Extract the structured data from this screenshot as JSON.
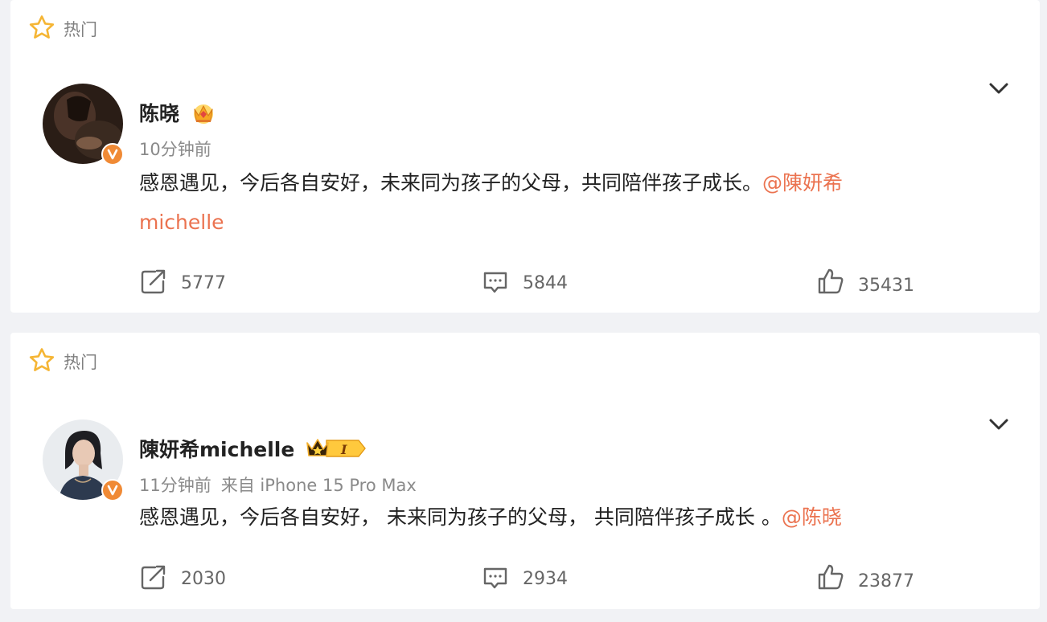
{
  "posts": [
    {
      "hot_label": "热门",
      "author": "陈晓",
      "time": "10分钟前",
      "source": "",
      "text_plain": "感恩遇见，今后各自安好，未来同为孩子的父母，共同陪伴孩子成长。",
      "mention_line1": "@陳妍希",
      "mention_line2": "michelle",
      "reposts": "5777",
      "comments": "5844",
      "likes": "35431"
    },
    {
      "hot_label": "热门",
      "author": "陳妍希michelle",
      "time": "11分钟前",
      "source": "来自 iPhone 15 Pro Max",
      "text_plain": "感恩遇见，今后各自安好， 未来同为孩子的父母， 共同陪伴孩子成长 。",
      "mention": "@陈晓",
      "reposts": "2030",
      "comments": "2934",
      "likes": "23877"
    }
  ],
  "icons": {
    "hot": "star-icon",
    "verified": "v-verified-icon",
    "crown": "crown-icon",
    "menu": "chevron-down-icon",
    "repost": "repost-icon",
    "comment": "comment-icon",
    "like": "thumbs-up-icon"
  },
  "colors": {
    "mention": "#eb7350",
    "star": "#f5b534",
    "verified": "#f08a35",
    "background": "#f1f2f5"
  }
}
